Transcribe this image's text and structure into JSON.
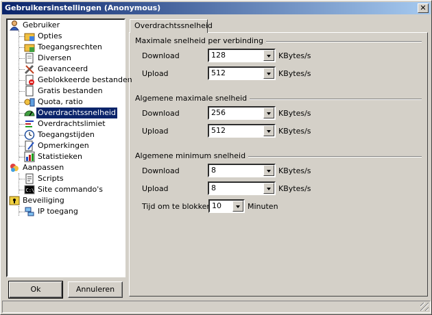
{
  "window": {
    "title": "Gebruikersinstellingen (Anonymous)",
    "close_glyph": "✕"
  },
  "tree": {
    "items": [
      {
        "label": "Gebruiker",
        "icon": "user-icon",
        "level": 0
      },
      {
        "label": "Opties",
        "icon": "folder-options-icon",
        "level": 1
      },
      {
        "label": "Toegangsrechten",
        "icon": "folder-access-icon",
        "level": 1
      },
      {
        "label": "Diversen",
        "icon": "document-icon",
        "level": 1
      },
      {
        "label": "Geavanceerd",
        "icon": "tools-icon",
        "level": 1
      },
      {
        "label": "Geblokkeerde bestanden",
        "icon": "blocked-file-icon",
        "level": 1
      },
      {
        "label": "Gratis bestanden",
        "icon": "file-icon",
        "level": 1
      },
      {
        "label": "Quota, ratio",
        "icon": "quota-icon",
        "level": 1
      },
      {
        "label": "Overdrachtssnelheid",
        "icon": "speedometer-icon",
        "level": 1,
        "selected": true
      },
      {
        "label": "Overdrachtslimiet",
        "icon": "limit-icon",
        "level": 1
      },
      {
        "label": "Toegangstijden",
        "icon": "clock-icon",
        "level": 1
      },
      {
        "label": "Opmerkingen",
        "icon": "notes-icon",
        "level": 1
      },
      {
        "label": "Statistieken",
        "icon": "statistics-icon",
        "level": 1
      },
      {
        "label": "Aanpassen",
        "icon": "customize-icon",
        "level": 0
      },
      {
        "label": "Scripts",
        "icon": "script-icon",
        "level": 1
      },
      {
        "label": "Site commando's",
        "icon": "console-icon",
        "level": 1
      },
      {
        "label": "Beveiliging",
        "icon": "security-icon",
        "level": 0
      },
      {
        "label": "IP toegang",
        "icon": "network-icon",
        "level": 1
      }
    ]
  },
  "buttons": {
    "ok": "Ok",
    "cancel": "Annuleren"
  },
  "tab": {
    "label": "Overdrachtssnelheid"
  },
  "groups": {
    "max_per_connection": {
      "title": "Maximale snelheid per verbinding",
      "download_label": "Download",
      "download_value": "128",
      "upload_label": "Upload",
      "upload_value": "512",
      "unit": "KBytes/s"
    },
    "global_max": {
      "title": "Algemene maximale snelheid",
      "download_label": "Download",
      "download_value": "256",
      "upload_label": "Upload",
      "upload_value": "512",
      "unit": "KBytes/s"
    },
    "global_min": {
      "title": "Algemene minimum snelheid",
      "download_label": "Download",
      "download_value": "8",
      "upload_label": "Upload",
      "upload_value": "8",
      "unit": "KBytes/s",
      "block_label": "Tijd om te blokkeren",
      "block_value": "10",
      "block_unit": "Minuten"
    }
  }
}
